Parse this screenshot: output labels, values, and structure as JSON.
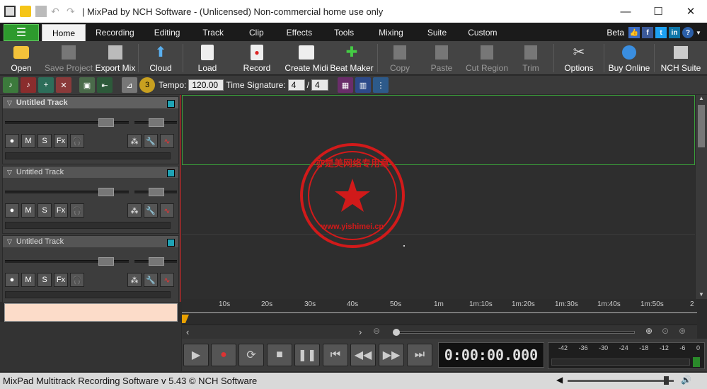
{
  "window": {
    "title": "| MixPad by NCH Software - (Unlicensed) Non-commercial home use only"
  },
  "menu": {
    "tabs": [
      "Home",
      "Recording",
      "Editing",
      "Track",
      "Clip",
      "Effects",
      "Tools",
      "Mixing",
      "Suite",
      "Custom"
    ],
    "active": "Home",
    "beta": "Beta"
  },
  "toolbar": {
    "open": "Open",
    "save_project": "Save Project",
    "export_mix": "Export Mix",
    "cloud": "Cloud",
    "load": "Load",
    "record": "Record",
    "create_midi": "Create Midi",
    "beat_maker": "Beat Maker",
    "copy": "Copy",
    "paste": "Paste",
    "cut_region": "Cut Region",
    "trim": "Trim",
    "options": "Options",
    "buy_online": "Buy Online",
    "nch_suite": "NCH Suite"
  },
  "subbar": {
    "tempo_label": "Tempo:",
    "tempo": "120.00",
    "timesig_label": "Time Signature:",
    "timesig_num": "4",
    "timesig_sep": "/",
    "timesig_den": "4",
    "metronome_count": "3"
  },
  "tracks": [
    {
      "name": "Untitled Track"
    },
    {
      "name": "Untitled Track"
    },
    {
      "name": "Untitled Track"
    }
  ],
  "track_buttons": {
    "record": "●",
    "mute": "M",
    "solo": "S",
    "fx": "Fx"
  },
  "ruler": {
    "ticks": [
      "10s",
      "20s",
      "30s",
      "40s",
      "50s",
      "1m",
      "1m:10s",
      "1m:20s",
      "1m:30s",
      "1m:40s",
      "1m:50s",
      "2"
    ]
  },
  "transport": {
    "time": "0:00:00.000"
  },
  "vu": {
    "scale": [
      "-42",
      "-36",
      "-30",
      "-24",
      "-18",
      "-12",
      "-6",
      "0"
    ]
  },
  "status": {
    "text": "MixPad Multitrack Recording Software v 5.43 © NCH Software"
  },
  "watermark": {
    "text": "亦是美网络专用章",
    "url": "www.yishimei.cn"
  },
  "colors": {
    "accent_green": "#2d9a2d",
    "track_square": "#1fa3b5",
    "new_track": "#fcdcc9",
    "stamp_red": "#d11a1a"
  }
}
